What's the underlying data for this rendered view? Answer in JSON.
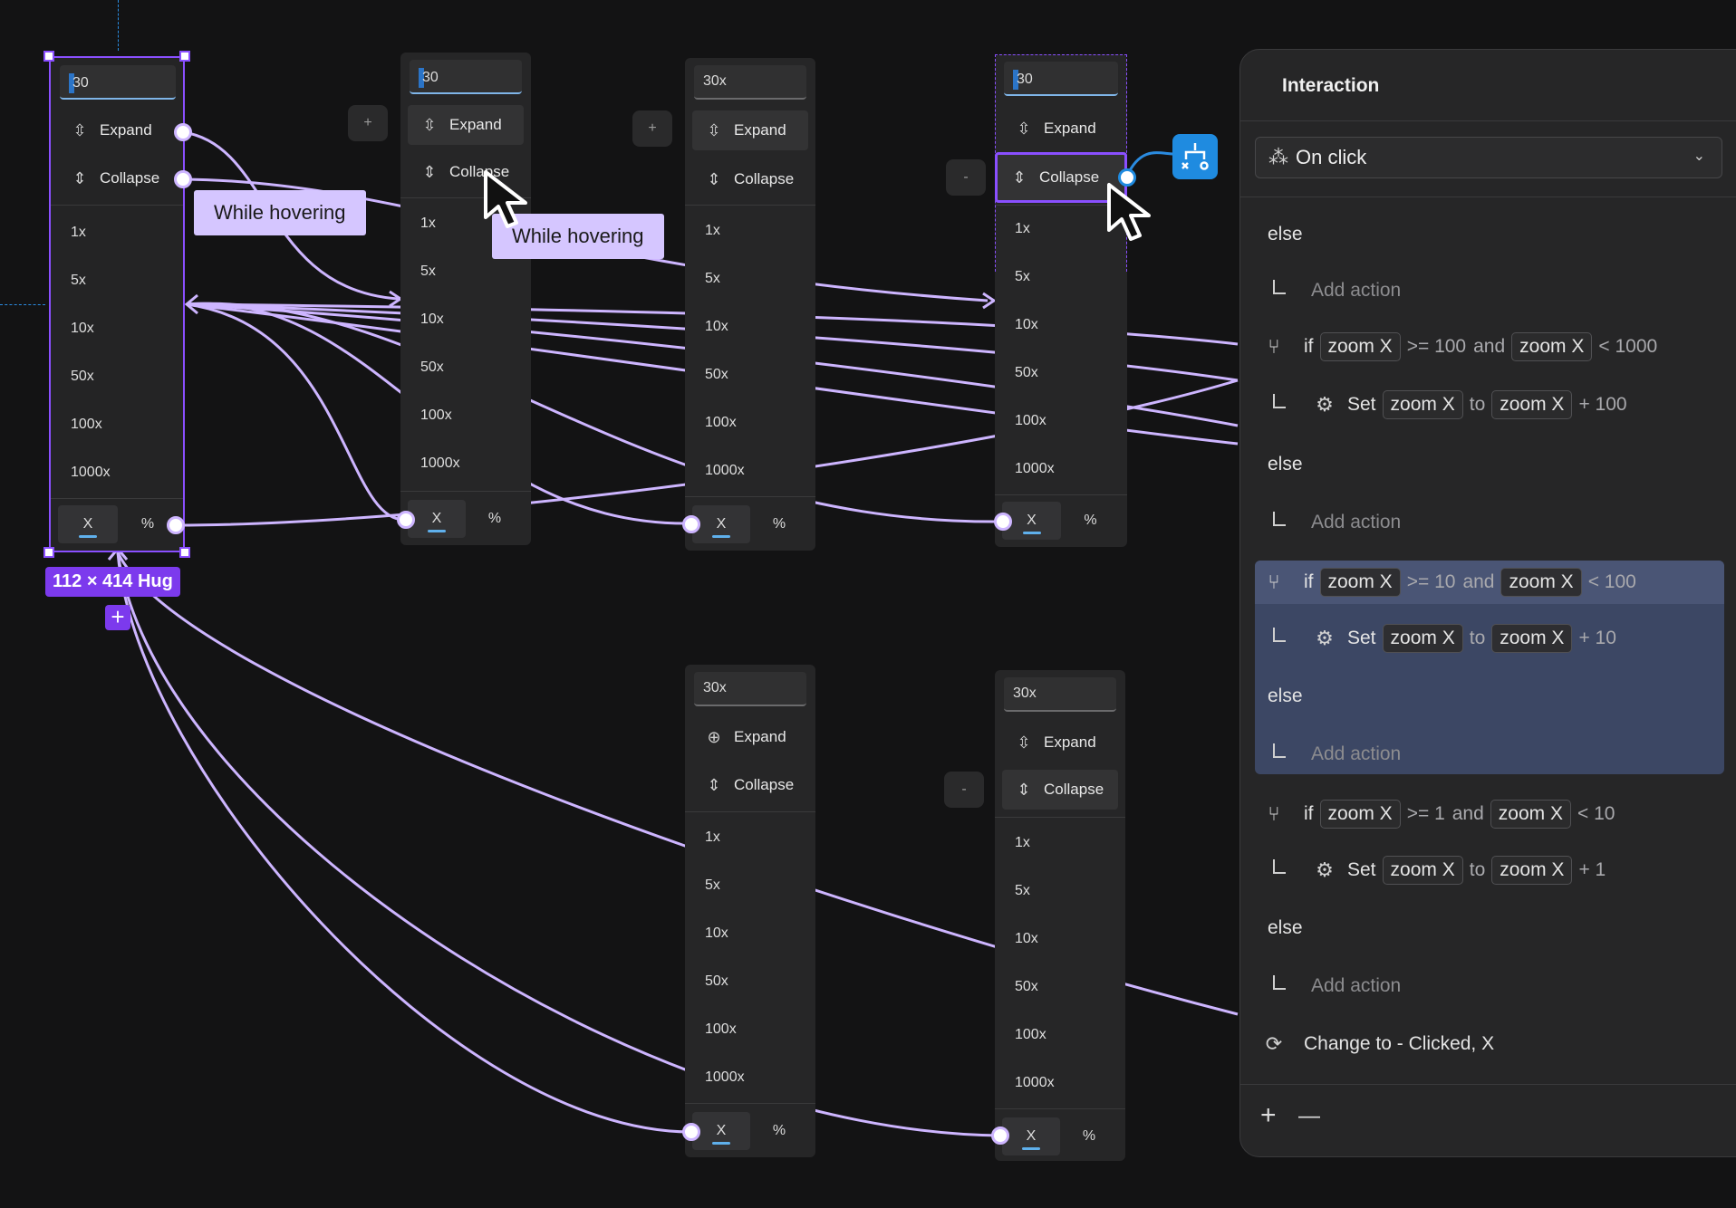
{
  "frames": {
    "input_value": "30",
    "input_value_x": "30x",
    "expand_label": "Expand",
    "collapse_label": "Collapse",
    "zoom_levels": [
      "1x",
      "5x",
      "10x",
      "50x",
      "100x",
      "1000x"
    ],
    "unit_x": "X",
    "unit_pct": "%",
    "plus_stub": "+",
    "minus_stub": "-"
  },
  "canvas": {
    "hover_tag_1": "While hovering",
    "hover_tag_2": "While hovering",
    "size_badge": "112 × 414 Hug",
    "add_badge": "+"
  },
  "panel": {
    "title": "Interaction",
    "trigger": "On click",
    "else_1": "else",
    "add_action_1": "Add action",
    "if1": {
      "kw": "if",
      "var1": "zoom X",
      "op1": ">= 100",
      "and": "and",
      "var2": "zoom X",
      "op2": "< 1000"
    },
    "set1": {
      "kw": "Set",
      "var": "zoom X",
      "to": "to",
      "val": "zoom X",
      "plus": "+ 100"
    },
    "else_2": "else",
    "add_action_2": "Add action",
    "if2": {
      "kw": "if",
      "var1": "zoom X",
      "op1": ">= 10",
      "and": "and",
      "var2": "zoom X",
      "op2": "< 100"
    },
    "set2": {
      "kw": "Set",
      "var": "zoom X",
      "to": "to",
      "val": "zoom X",
      "plus": "+ 10"
    },
    "else_3": "else",
    "add_action_3": "Add action",
    "if3": {
      "kw": "if",
      "var1": "zoom X",
      "op1": ">= 1",
      "and": "and",
      "var2": "zoom X",
      "op2": "< 10"
    },
    "set3": {
      "kw": "Set",
      "var": "zoom X",
      "to": "to",
      "val": "zoom X",
      "plus": "+ 1"
    },
    "else_4": "else",
    "add_action_4": "Add action",
    "change": "Change to - Clicked, X",
    "footer_add": "+",
    "footer_remove": "—"
  }
}
